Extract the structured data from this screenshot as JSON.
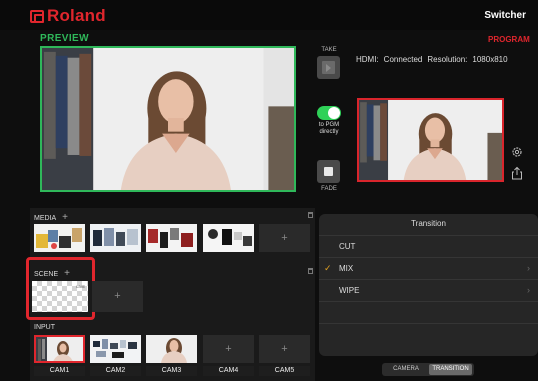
{
  "header": {
    "brand": "Roland",
    "title": "Switcher"
  },
  "preview": {
    "label": "PREVIEW"
  },
  "program": {
    "label": "PROGRAM"
  },
  "hdmi_status": {
    "label": "HDMI:",
    "state": "Connected",
    "resolution_label": "Resolution:",
    "resolution": "1080x810"
  },
  "controls": {
    "take_label": "TAKE",
    "pgm_direct_line1": "to PGM",
    "pgm_direct_line2": "directly",
    "pgm_direct_on": true,
    "fade_label": "FADE"
  },
  "media": {
    "label": "MEDIA",
    "add": "+",
    "items": [
      {
        "name": "media-1"
      },
      {
        "name": "media-2"
      },
      {
        "name": "media-3"
      },
      {
        "name": "media-4"
      }
    ]
  },
  "scene": {
    "label": "SCENE",
    "add": "+",
    "tag": "LIVE"
  },
  "input": {
    "label": "INPUT",
    "cams": [
      "CAM1",
      "CAM2",
      "CAM3",
      "CAM4",
      "CAM5"
    ]
  },
  "transition_panel": {
    "title": "Transition",
    "options": [
      "CUT",
      "MIX",
      "WIPE"
    ],
    "selected": "MIX"
  },
  "tabs": {
    "camera": "CAMERA",
    "transition": "TRANSITION",
    "active": "TRANSITION"
  },
  "colors": {
    "brand_red": "#e0262d",
    "preview_green": "#2fb85a",
    "toggle_green": "#2fd158",
    "check_amber": "#e0a020"
  }
}
